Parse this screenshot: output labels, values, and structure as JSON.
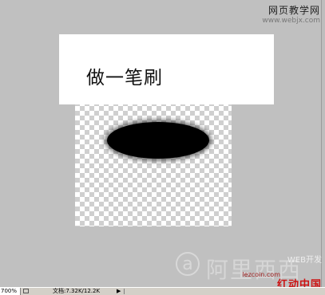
{
  "canvas": {
    "label": "做一笔刷"
  },
  "watermarks": {
    "top_cn": "网页教学网",
    "top_en": "www.webjx.com",
    "logo_glyph": "a",
    "logo_text": "阿里西西",
    "webdev": "WEB开发",
    "site": "lezcoin.com",
    "red_text": "红动中国"
  },
  "statusbar": {
    "zoom": "700%",
    "doc_info": "文档:7.32K/12.2K",
    "arrow": "▶"
  },
  "colors": {
    "workspace": "#c0c0c0",
    "statusbar": "#d4d0c8",
    "brush": "#000000",
    "red_watermark": "#cc1111"
  }
}
